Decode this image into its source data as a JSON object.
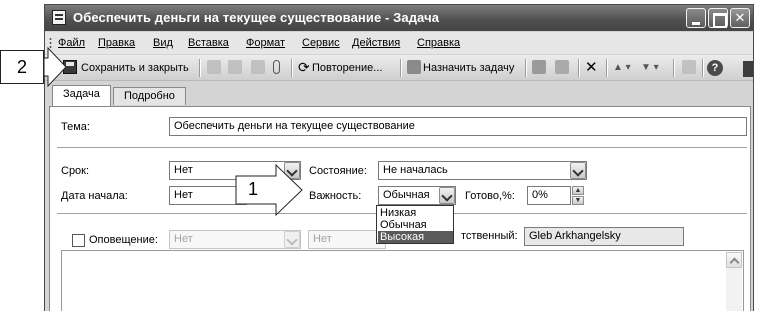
{
  "window": {
    "title": "Обеспечить деньги на текущее существование - Задача",
    "minimize": "_",
    "restore": "",
    "close": "✕"
  },
  "menu": [
    {
      "label": "Файл"
    },
    {
      "label": "Правка"
    },
    {
      "label": "Вид"
    },
    {
      "label": "Вставка"
    },
    {
      "label": "Формат"
    },
    {
      "label": "Сервис"
    },
    {
      "label": "Действия"
    },
    {
      "label": "Справка"
    }
  ],
  "toolbar": {
    "save_close": "Сохранить и закрыть",
    "recurrence": "Повторение...",
    "assign": "Назначить задачу",
    "delete_glyph": "✕",
    "help_glyph": "?"
  },
  "tabs": [
    {
      "label": "Задача",
      "active": true
    },
    {
      "label": "Подробно",
      "active": false
    }
  ],
  "form": {
    "subject_label": "Тема:",
    "subject_value": "Обеспечить деньги на текущее существование",
    "due_label": "Срок:",
    "due_value": "Нет",
    "start_label": "Дата начала:",
    "start_value": "Нет",
    "status_label": "Состояние:",
    "status_value": "Не началась",
    "priority_label": "Важность:",
    "priority_value": "Обычная",
    "complete_label": "Готово,%:",
    "complete_value": "0%",
    "reminder_label": "Оповещение:",
    "reminder_date": "Нет",
    "reminder_time": "Нет",
    "owner_label": "тственный:",
    "owner_value": "Gleb Arkhangelsky"
  },
  "priority_dropdown": {
    "options": [
      "Низкая",
      "Обычная",
      "Высокая"
    ],
    "highlighted": "Высокая"
  },
  "callouts": {
    "one": "1",
    "two": "2"
  },
  "colors": {
    "titlebar": "#4f4f4f",
    "panel": "#ffffff",
    "selection": "#5a5a5a"
  }
}
